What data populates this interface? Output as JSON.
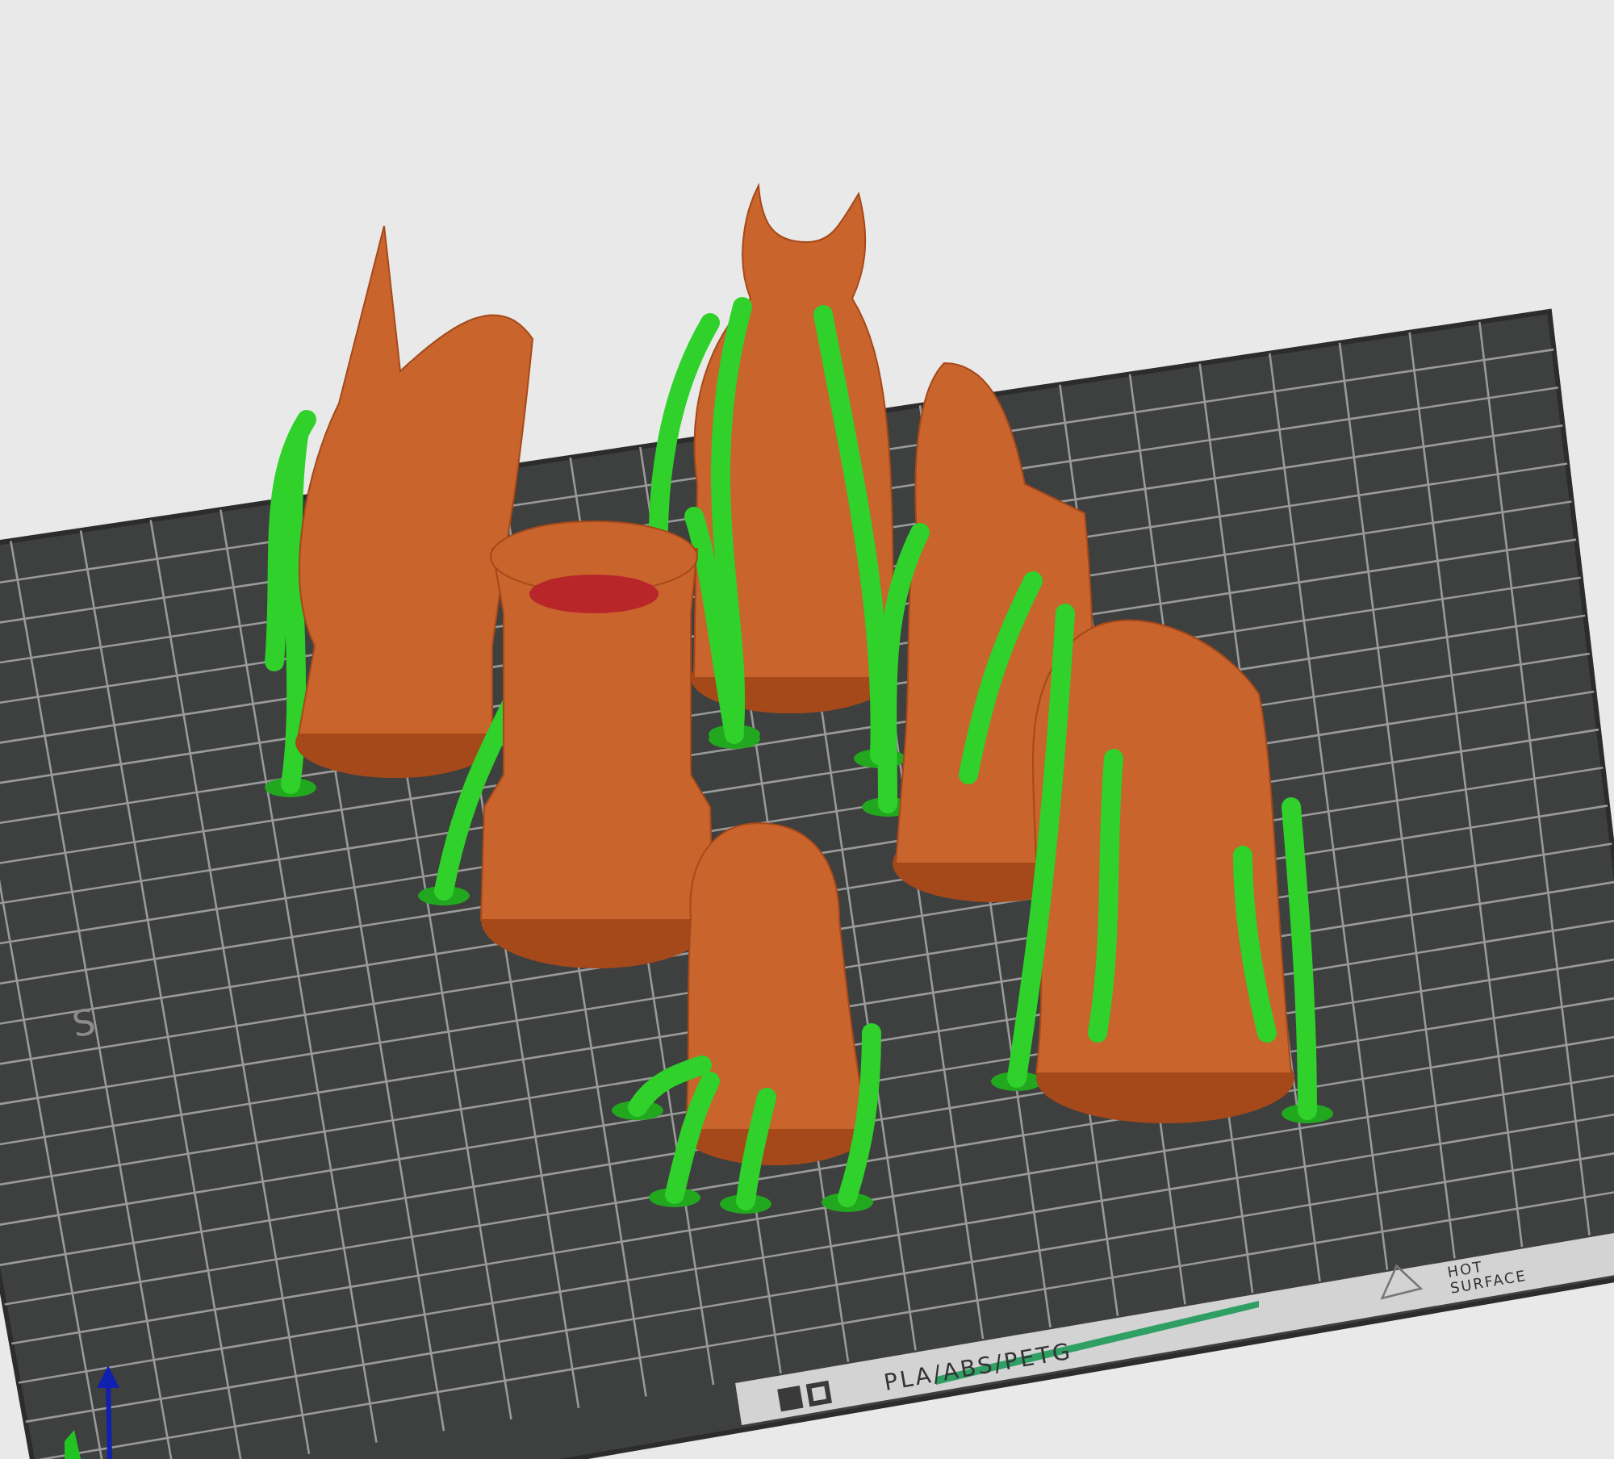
{
  "viewport": {
    "edge_text": "S",
    "plate_label": "PLA/ABS/PETG",
    "warning_lines": [
      "HOT",
      "SURFACE"
    ]
  }
}
